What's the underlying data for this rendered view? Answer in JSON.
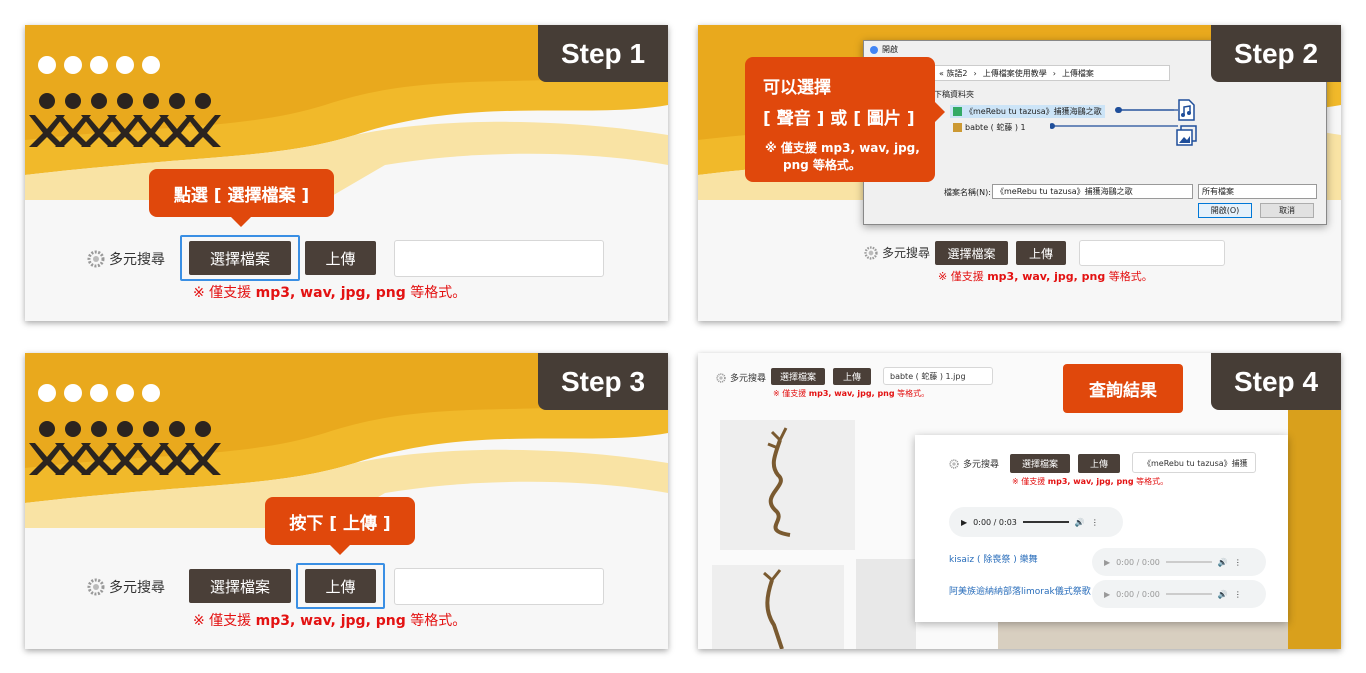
{
  "steps": {
    "s1": "Step 1",
    "s2": "Step 2",
    "s3": "Step 3",
    "s4": "Step 4"
  },
  "search": {
    "label": "多元搜尋",
    "choose_file": "選擇檔案",
    "upload": "上傳",
    "note_prefix": "※ 僅支援",
    "note_formats": "mp3, wav, jpg, png",
    "note_suffix": "等格式。"
  },
  "callouts": {
    "step1": "點選 [ 選擇檔案 ]",
    "step2_line1": "可以選擇",
    "step2_line2": "[ 聲音 ] 或 [ 圖片 ]",
    "step2_sub1": "※ 僅支援 mp3, wav, jpg,",
    "step2_sub2": "png 等格式。",
    "step3": "按下 [ 上傳 ]",
    "step4": "查詢結果"
  },
  "dialog": {
    "title": "開啟",
    "breadcrumb": [
      "« 族語2",
      "上傳檔案使用教學",
      "上傳檔案"
    ],
    "sidebar_label": "下稿資料夾",
    "files": [
      "《meRebu tu tazusa》捕獲海鷗之歌",
      "babte ( 蛇藤 ) 1"
    ],
    "filename_label": "檔案名稱(N):",
    "filename_value": "《meRebu tu tazusa》捕獲海鷗之歌",
    "filetype_value": "所有檔案",
    "open_btn": "開啟(O)",
    "cancel_btn": "取消"
  },
  "step4": {
    "top_file": "babte ( 蛇藤 ) 1.jpg",
    "result_file": "《meRebu tu tazusa》捕獲",
    "player_main_time": "0:00 / 0:03",
    "results": [
      {
        "title": "kisaiz ( 除喪祭 ) 樂舞",
        "time": "0:00 / 0:00"
      },
      {
        "title": "阿美族逾納納部落limorak儀式祭歌",
        "time": "0:00 / 0:00"
      }
    ]
  },
  "colors": {
    "accent_orange": "#e0480c",
    "dark_brown": "#463d36",
    "note_red": "#e31212",
    "highlight_blue": "#3a8fe4",
    "banner_yellow": "#f1b92a"
  }
}
